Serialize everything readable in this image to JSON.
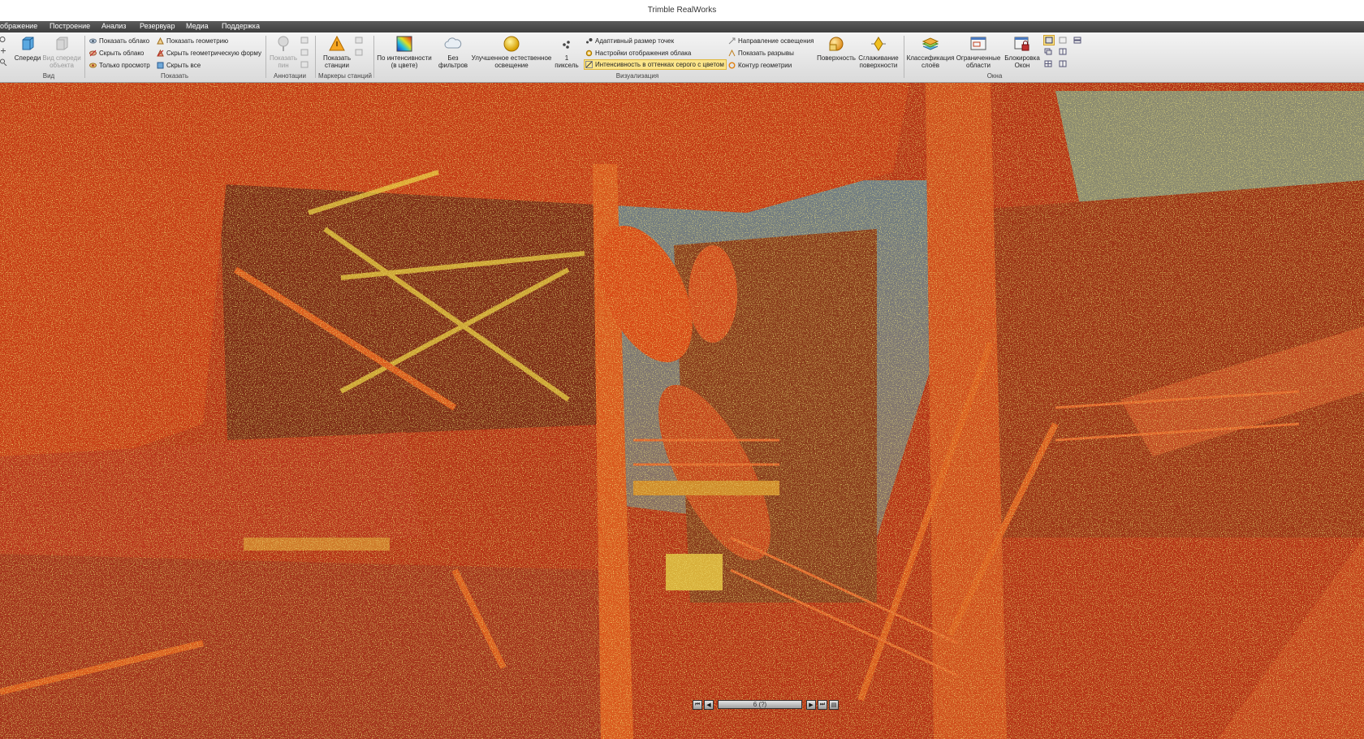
{
  "window": {
    "title": "Trimble RealWorks"
  },
  "menu": [
    "ображение",
    "Построение",
    "Анализ",
    "Резервуар",
    "Медиа",
    "Поддержка"
  ],
  "groups": {
    "view": {
      "label": "Вид",
      "front": "Спереди",
      "object_front_1": "Вид спереди",
      "object_front_2": "объекта"
    },
    "show": {
      "label": "Показать",
      "show_cloud": "Показать облако",
      "hide_cloud": "Скрыть облако",
      "view_only": "Только просмотр",
      "show_geometry": "Показать геометрию",
      "hide_geometry_form": "Скрыть геометрическую форму",
      "hide_all": "Скрыть все"
    },
    "annotations": {
      "label": "Аннотации",
      "show_pin_1": "Показать",
      "show_pin_2": "пин"
    },
    "station_markers": {
      "label": "Маркеры станций",
      "show_stations_1": "Показать",
      "show_stations_2": "станции"
    },
    "visualization": {
      "label": "Визуализация",
      "by_intensity_1": "По интенсивности",
      "by_intensity_2": "(в цвете)",
      "no_filters_1": "Без",
      "no_filters_2": "фильтров",
      "enhanced_lighting_1": "Улучшенное естественное",
      "enhanced_lighting_2": "освещение",
      "point_size_1": "1",
      "point_size_2": "пиксель",
      "adaptive_point_size": "Адаптивный размер точек",
      "cloud_display_settings": "Настройки отображения облака",
      "gray_intensity_color": "Интенсивность в оттенках серого с цветом",
      "light_direction": "Направление освещения",
      "show_gaps": "Показать разрывы",
      "geometry_contour": "Контур геометрии",
      "surface": "Поверхность",
      "smoothing_1": "Сглаживание",
      "smoothing_2": "поверхности"
    },
    "windows": {
      "label": "Окна",
      "layer_classification_1": "Классификация",
      "layer_classification_2": "слоёв",
      "limiting_boxes_1": "Ограниченные",
      "limiting_boxes_2": "области",
      "lock_windows_1": "Блокировка",
      "lock_windows_2": "Окон"
    }
  },
  "station_nav": {
    "label": "6 (?)"
  },
  "colors": {
    "accent_highlight": "#fbe58a",
    "pointcloud_red": "#d23a14",
    "pointcloud_orange": "#e8701e",
    "pointcloud_yellow": "#d9c83a",
    "sky_gray": "#7a7e80"
  }
}
